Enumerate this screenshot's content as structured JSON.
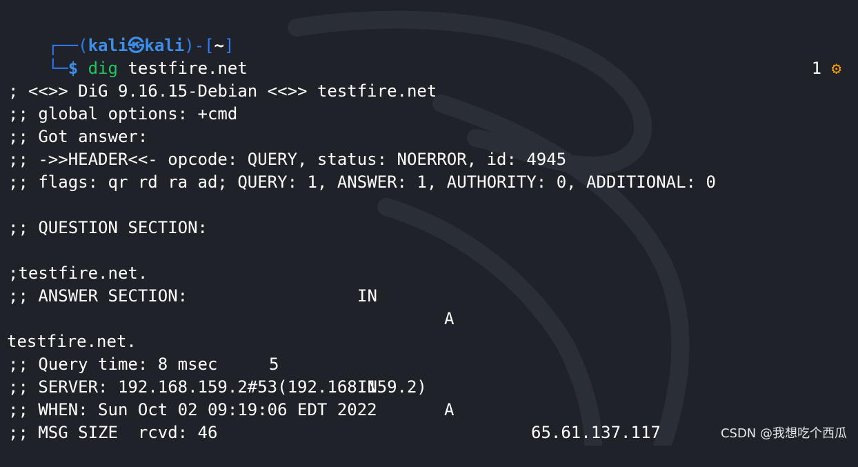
{
  "prompt": {
    "frame_open": "┌──(",
    "user_host": "kali㉿kali",
    "frame_mid": ")-[",
    "dir": "~",
    "frame_close": "]",
    "corner": "└─",
    "dollar": "$",
    "command": "dig",
    "argument": "testfire.net",
    "status_count": "1",
    "status_icon": "gear-icon"
  },
  "output": {
    "banner": "; <<>> DiG 9.16.15-Debian <<>> testfire.net",
    "global_options": ";; global options: +cmd",
    "got_answer": ";; Got answer:",
    "header": ";; ->>HEADER<<- opcode: QUERY, status: NOERROR, id: 4945",
    "flags": ";; flags: qr rd ra ad; QUERY: 1, ANSWER: 1, AUTHORITY: 0, ADDITIONAL: 0",
    "question_title": ";; QUESTION SECTION:",
    "question": {
      "name": ";testfire.net.",
      "class": "IN",
      "type": "A"
    },
    "answer_title": ";; ANSWER SECTION:",
    "answer": {
      "name": "testfire.net.",
      "ttl": "5",
      "class": "IN",
      "type": "A",
      "address": "65.61.137.117"
    },
    "query_time": ";; Query time: 8 msec",
    "server": ";; SERVER: 192.168.159.2#53(192.168.159.2)",
    "when": ";; WHEN: Sun Oct 02 09:19:06 EDT 2022",
    "msg_size": ";; MSG SIZE  rcvd: 46"
  },
  "watermark": "CSDN @我想吃个西瓜",
  "colors": {
    "background": "#1f2229",
    "prompt_blue": "#3b8eea",
    "command_green": "#22c55e",
    "gear_orange": "#f59e0b"
  }
}
